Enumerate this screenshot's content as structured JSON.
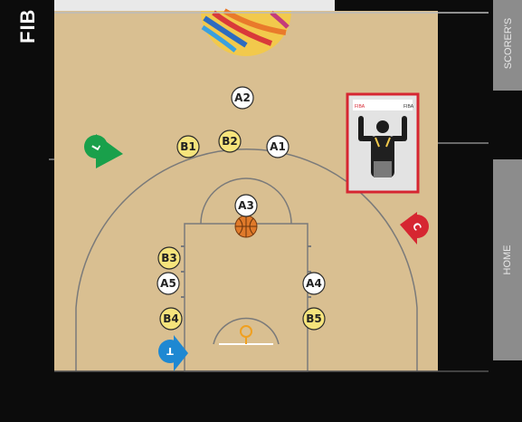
{
  "brand": {
    "text": "FIB"
  },
  "side_panels": {
    "scorer_label": "SCORER'S",
    "home_label": "HOME"
  },
  "colors": {
    "floor": "#d9bf91",
    "court_line": "#777777",
    "team_a_fill": "#ffffff",
    "team_b_fill": "#f6e47c",
    "referee_green": "#19a04b",
    "referee_red": "#d62631",
    "referee_blue": "#1e88d2",
    "ball": "#e07a2a"
  },
  "players": [
    {
      "id": "A2",
      "team": "A"
    },
    {
      "id": "B1",
      "team": "B"
    },
    {
      "id": "B2",
      "team": "B"
    },
    {
      "id": "A1",
      "team": "A"
    },
    {
      "id": "A3",
      "team": "A"
    },
    {
      "id": "B3",
      "team": "B"
    },
    {
      "id": "A5",
      "team": "A"
    },
    {
      "id": "A4",
      "team": "A"
    },
    {
      "id": "B4",
      "team": "B"
    },
    {
      "id": "B5",
      "team": "B"
    }
  ],
  "referees": [
    {
      "label": "L",
      "color": "green",
      "role": "lead"
    },
    {
      "label": "C",
      "color": "red",
      "role": "center"
    },
    {
      "label": "T",
      "color": "blue",
      "role": "trail"
    }
  ],
  "signal_card": {
    "top_left_text": "FIBA",
    "top_right_text": "FIBA"
  }
}
